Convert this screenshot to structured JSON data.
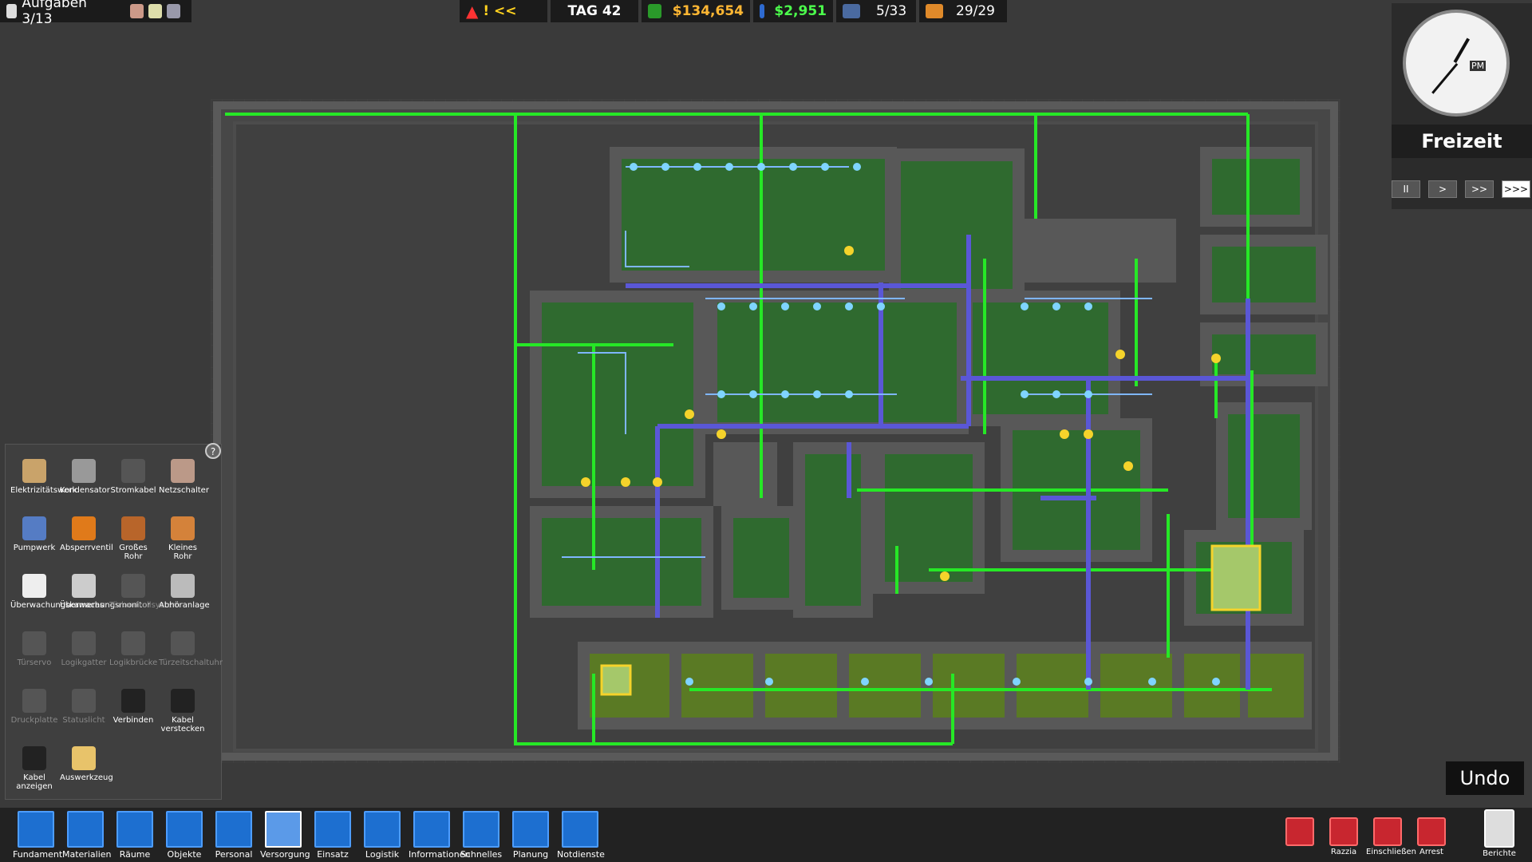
{
  "top": {
    "tasks_label": "Aufgaben 3/13",
    "alert_text": "! <<",
    "day_label": "TAG 42",
    "balance": "$134,654",
    "income": "$2,951",
    "guards": "5/33",
    "prisoners": "29/29"
  },
  "clock": {
    "period": "PM",
    "regime": "Freizeit",
    "speeds": [
      "II",
      ">",
      ">>",
      ">>>"
    ],
    "active_speed": 3
  },
  "tools": {
    "help": "?",
    "items": [
      {
        "label": "Elektrizitätswerk",
        "enabled": true
      },
      {
        "label": "Kondensator",
        "enabled": true
      },
      {
        "label": "Stromkabel",
        "enabled": true
      },
      {
        "label": "Netzschalter",
        "enabled": true
      },
      {
        "label": "Pumpwerk",
        "enabled": true
      },
      {
        "label": "Absperrventil",
        "enabled": true
      },
      {
        "label": "Großes Rohr",
        "enabled": true
      },
      {
        "label": "Kleines Rohr",
        "enabled": true
      },
      {
        "label": "Überwachungskameras",
        "enabled": true
      },
      {
        "label": "Überwachungsmonitor",
        "enabled": true
      },
      {
        "label": "Türkontrollsystem",
        "enabled": false
      },
      {
        "label": "Abhöranlage",
        "enabled": true
      },
      {
        "label": "Türservo",
        "enabled": false
      },
      {
        "label": "Logikgatter",
        "enabled": false
      },
      {
        "label": "Logikbrücke",
        "enabled": false
      },
      {
        "label": "Türzeitschaltuhr",
        "enabled": false
      },
      {
        "label": "Druckplatte",
        "enabled": false
      },
      {
        "label": "Statuslicht",
        "enabled": false
      },
      {
        "label": "Verbinden",
        "enabled": true
      },
      {
        "label": "Kabel verstecken",
        "enabled": true
      },
      {
        "label": "Kabel anzeigen",
        "enabled": true
      },
      {
        "label": "Auswerkzeug",
        "enabled": true
      }
    ]
  },
  "bottom": {
    "buttons": [
      "Fundament",
      "Materialien",
      "Räume",
      "Objekte",
      "Personal",
      "Versorgung",
      "Einsatz",
      "Logistik",
      "Informationen",
      "Schnelles",
      "Planung",
      "Notdienste"
    ],
    "active": "Versorgung",
    "actions": [
      "",
      "Razzia",
      "Einschließen",
      "Arrest"
    ],
    "reports": "Berichte"
  },
  "undo": "Undo",
  "colors": {
    "power": "#26e826",
    "water": "#5a57d6",
    "room": "#2f6a2f",
    "wall": "#555555"
  }
}
